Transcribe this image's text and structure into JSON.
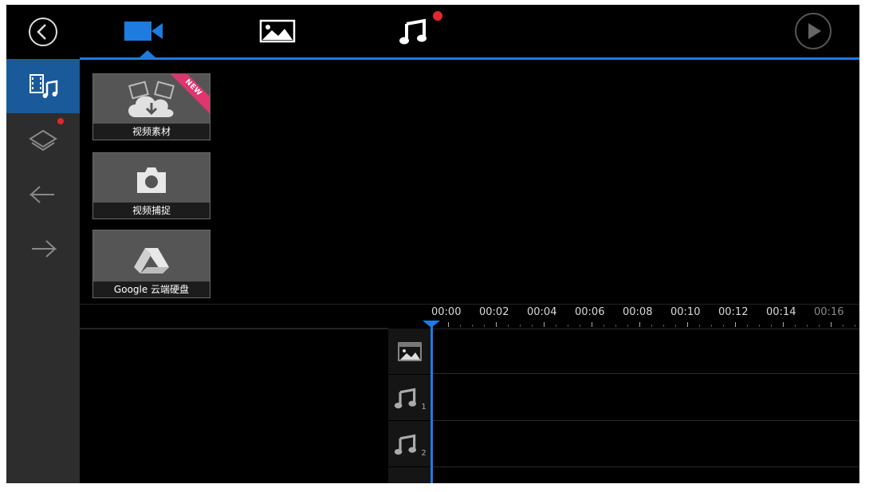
{
  "sidebar": {
    "items": [
      {
        "name": "back",
        "icon": "back-circle-icon"
      },
      {
        "name": "media",
        "icon": "media-music-icon",
        "active": true
      },
      {
        "name": "layers",
        "icon": "layers-icon",
        "badge": true
      },
      {
        "name": "undo",
        "icon": "undo-arrow-icon"
      },
      {
        "name": "redo",
        "icon": "redo-arrow-icon"
      }
    ]
  },
  "tabs": [
    {
      "name": "video",
      "icon": "video-camera-icon",
      "active": true
    },
    {
      "name": "image",
      "icon": "image-icon"
    },
    {
      "name": "music",
      "icon": "music-note-icon",
      "badge": true
    }
  ],
  "play_button": {
    "icon": "play-icon"
  },
  "tiles": [
    {
      "label": "视频素材",
      "icon": "cloud-download-icon",
      "ribbon": "NEW"
    },
    {
      "label": "视频捕捉",
      "icon": "camera-icon"
    },
    {
      "label": "Google 云端硬盘",
      "icon": "google-drive-icon"
    }
  ],
  "timeline": {
    "ticks": [
      "00:00",
      "00:02",
      "00:04",
      "00:06",
      "00:08",
      "00:10",
      "00:12",
      "00:14",
      "00:16"
    ],
    "tracks": [
      {
        "name": "image-track",
        "icon": "image-strip-icon",
        "num": ""
      },
      {
        "name": "music-track-1",
        "icon": "music-note-icon",
        "num": "1"
      },
      {
        "name": "music-track-2",
        "icon": "music-note-icon",
        "num": "2"
      }
    ]
  },
  "colors": {
    "accent": "#1e7be0",
    "badge": "#e0282e",
    "ribbon": "#e0356e",
    "sidebar_bg": "#2d2d2d",
    "active_bg": "#1a5a9a"
  }
}
